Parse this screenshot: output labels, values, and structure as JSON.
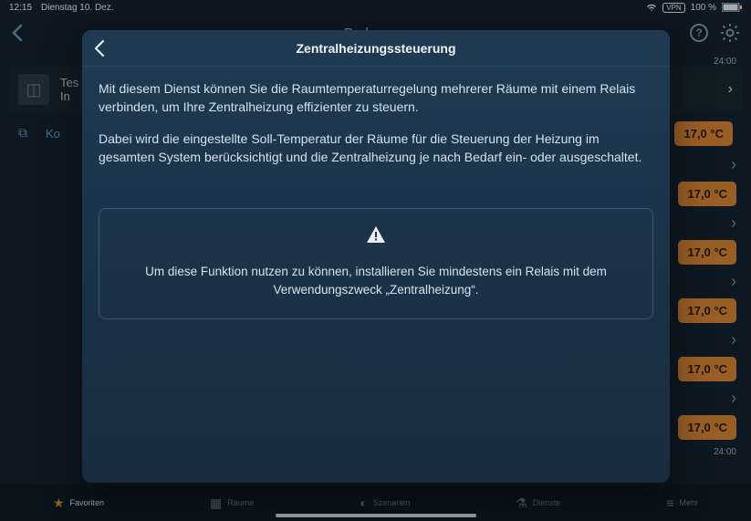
{
  "statusbar": {
    "time": "12:15",
    "date": "Dienstag 10. Dez.",
    "batteryText": "100 %",
    "vpn": "VPN"
  },
  "header": {
    "title": "Bad"
  },
  "main": {
    "time_marker": "24:00",
    "time_marker_bottom": "24:00",
    "card": {
      "line1": "Tes",
      "line2": "In"
    },
    "kon": "Ko",
    "temps": [
      "17,0 °C",
      "17,0 °C",
      "17,0 °C",
      "17,0 °C",
      "17,0 °C",
      "17,0 °C"
    ]
  },
  "tabs": {
    "fav": "Favoriten",
    "rooms": "Räume",
    "scen": "Szenarien",
    "serv": "Dienste",
    "more": "Mehr"
  },
  "modal": {
    "title": "Zentralheizungssteuerung",
    "p1": "Mit diesem Dienst können Sie die Raumtemperaturregelung mehrerer Räume mit einem Relais verbinden, um Ihre Zentralheizung effizienter zu steuern.",
    "p2": "Dabei wird die eingestellte Soll-Temperatur der Räume für die Steuerung der Heizung im gesamten System berücksichtigt und die Zentralheizung je nach Bedarf ein- oder ausgeschaltet.",
    "alert": "Um diese Funktion nutzen zu können, installieren Sie mindestens ein Relais mit dem Verwendungszweck „Zentralheizung“."
  }
}
